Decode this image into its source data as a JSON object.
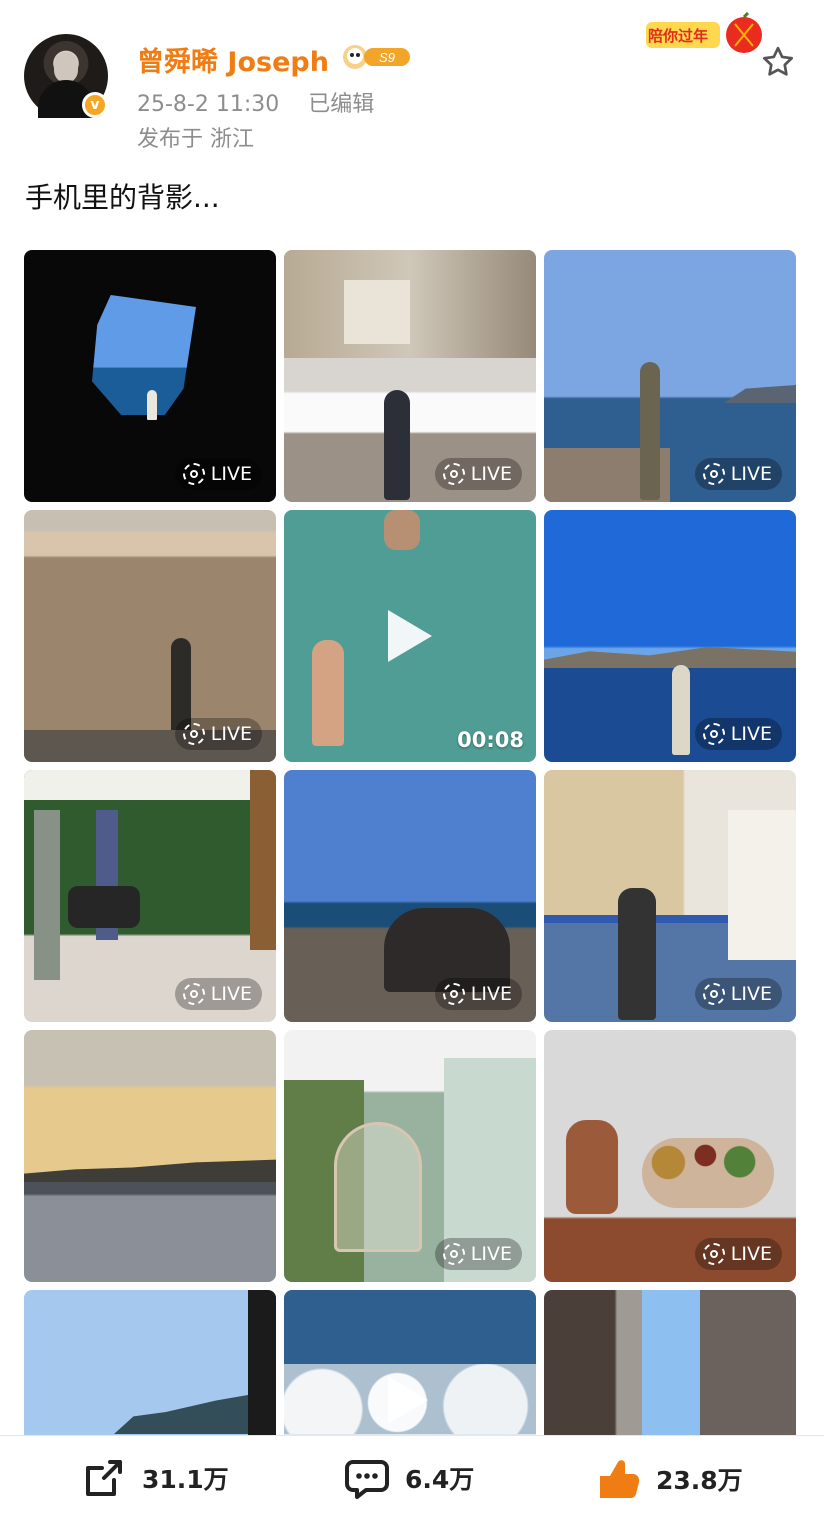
{
  "post": {
    "username": "曾舜晞 Joseph",
    "level_badge": "S9",
    "time": "25-8-2 11:30",
    "edited": "已编辑",
    "location": "发布于 浙江",
    "festival_tag": "陪你过年",
    "content": "手机里的背影..."
  },
  "media": {
    "tiles": [
      {
        "type": "live",
        "badge": "LIVE"
      },
      {
        "type": "live",
        "badge": "LIVE"
      },
      {
        "type": "live",
        "badge": "LIVE"
      },
      {
        "type": "live",
        "badge": "LIVE"
      },
      {
        "type": "video",
        "badge": "00:08"
      },
      {
        "type": "live",
        "badge": "LIVE"
      },
      {
        "type": "live",
        "badge": "LIVE"
      },
      {
        "type": "live",
        "badge": "LIVE"
      },
      {
        "type": "live",
        "badge": "LIVE"
      },
      {
        "type": "image",
        "badge": ""
      },
      {
        "type": "live",
        "badge": "LIVE"
      },
      {
        "type": "live",
        "badge": "LIVE"
      },
      {
        "type": "image",
        "badge": ""
      },
      {
        "type": "video",
        "badge": ""
      },
      {
        "type": "image",
        "badge": ""
      }
    ]
  },
  "actions": {
    "share_count": "31.1万",
    "comment_count": "6.4万",
    "like_count": "23.8万"
  },
  "colors": {
    "username": "#f07c14",
    "meta_text": "#8d8d8d",
    "like": "#f07c14"
  }
}
